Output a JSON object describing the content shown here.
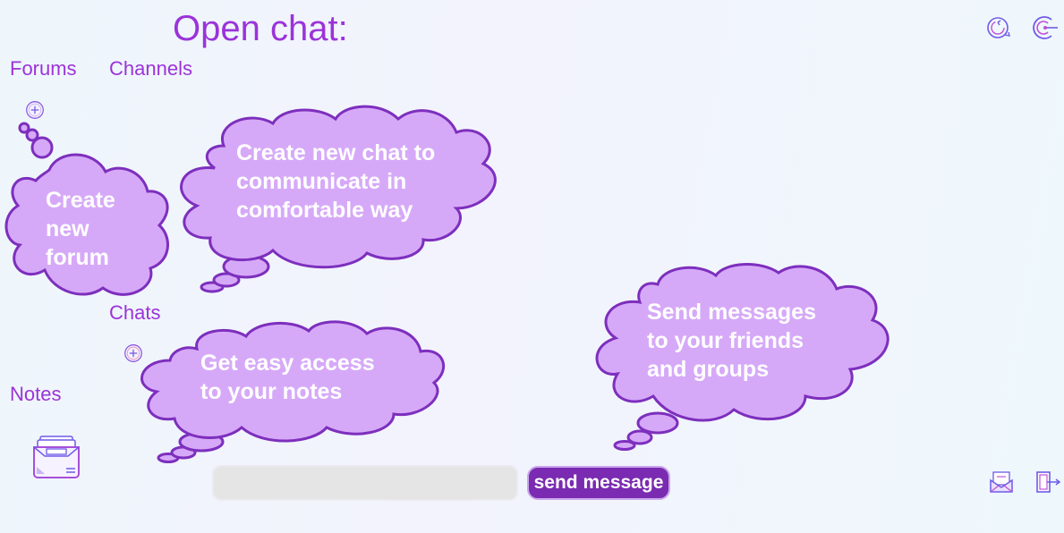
{
  "header": {
    "title": "Open chat:"
  },
  "nav": {
    "forums": "Forums",
    "channels": "Channels",
    "chats": "Chats",
    "notes": "Notes"
  },
  "tips": {
    "create_forum": [
      "Create",
      "new",
      "forum"
    ],
    "create_chat": [
      "Create new chat to",
      "communicate in",
      "comfortable way"
    ],
    "notes_access": [
      "Get easy access",
      "to your notes"
    ],
    "send_messages": [
      "Send messages",
      "to your friends",
      "and groups"
    ]
  },
  "composer": {
    "input_value": "",
    "input_placeholder": "",
    "send_label": "send message"
  },
  "icons": {
    "refresh": "refresh-icon",
    "logout_top": "power-icon",
    "notes_tray": "inbox-tray-icon",
    "mail": "open-mail-icon",
    "exit": "exit-door-icon",
    "add": "plus-circle-icon"
  },
  "colors": {
    "accent": "#9b33d9",
    "cloud_fill": "#d6a9f8",
    "cloud_stroke": "#7d2fbd",
    "button_bg": "#7a2bb1",
    "input_bg": "#e5e5e5"
  }
}
